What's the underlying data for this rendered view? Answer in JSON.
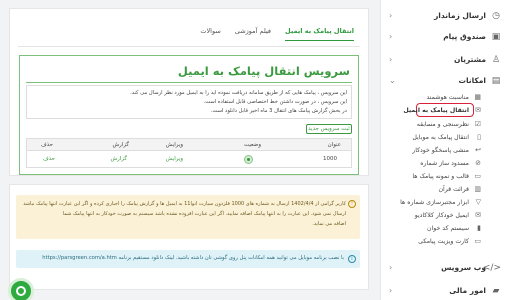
{
  "sidebar": {
    "items": [
      {
        "label": "ارسال زماندار",
        "icon": "clock-icon"
      },
      {
        "label": "صندوق پیام",
        "icon": "inbox-icon"
      },
      {
        "label": "مشتریان",
        "icon": "users-icon"
      },
      {
        "label": "امکانات",
        "icon": "document-icon"
      }
    ],
    "sub_items": [
      {
        "label": "مناسبت هوشمند"
      },
      {
        "label": "انتقال پیامک به ایمیل"
      },
      {
        "label": "نظرسنجی و مسابقه"
      },
      {
        "label": "انتقال پیامک به موبایل"
      },
      {
        "label": "منشی پاسخگو خودکار"
      },
      {
        "label": "مسدود ساز شماره"
      },
      {
        "label": "قالب و نمونه پیامک ها"
      },
      {
        "label": "قرائت قرآن"
      },
      {
        "label": "ابزار مجتبرسازی شماره ها"
      },
      {
        "label": "ایمیل خودکار کلاکادیو"
      },
      {
        "label": "سیستم کد خوان"
      },
      {
        "label": "کارت ویزیت پیامکی"
      }
    ],
    "bottom_items": [
      {
        "label": "وب سرویس",
        "icon": "code-icon"
      },
      {
        "label": "امور مالی",
        "icon": "wallet-icon"
      }
    ]
  },
  "tabs": [
    {
      "label": "انتقال پیامک به ایمیل"
    },
    {
      "label": "فیلم آموزشی"
    },
    {
      "label": "سوالات"
    }
  ],
  "panel": {
    "title": "سرویس انتقال پیامک به ایمیل",
    "notes": [
      "این سرویس ، پیامک هایی که از طریق سامانه دریافت نموده اید را به ایمیل مورد نظر ارسال می کند.",
      "این سرویس ، در صورت داشتن خط اختصاصی قابل استفاده است.",
      "در بخش گزارش پیامک های انتقال 3 ماه اخیر قابل دانلود است."
    ],
    "new_button": "ثبت سرویس جدید",
    "table": {
      "headers": [
        "عنوان",
        "وضعیت",
        "ویرایش",
        "گزارش",
        "حذف"
      ],
      "rows": [
        {
          "title": "1000",
          "edit": "ویرایش",
          "report": "گزارش",
          "delete": "حذف"
        }
      ]
    }
  },
  "warning": {
    "lines": [
      "کاربر گرامی از 1402/4/4 ارسال به شماره های 1000 فلزدون سیارت اتوا11 به ایمیل ها و گزارش پیامک را اجباری کرده و اگر این عبارت انتها پیامک نباشد پیامک",
      "ارسال نمی شود. این عبارت را به انتها پیامک اضافه نمایید. اگر این عبارت افزوده نشده باشد سیستم به صورت خودکار به انتها پیامک شما",
      "اضافه می نماید."
    ]
  },
  "info": {
    "text": "با نصب برنامه موبایل می توانید همه امکانات پنل روی گوشی تان داشته باشید. لینک دانلود مستقیم برنامه https://parsgreen.com/a.htm"
  },
  "colors": {
    "accent": "#2e9a3c",
    "highlight": "#d9213a",
    "warning_bg": "#fbf1d6",
    "info_bg": "#dff2f8"
  }
}
